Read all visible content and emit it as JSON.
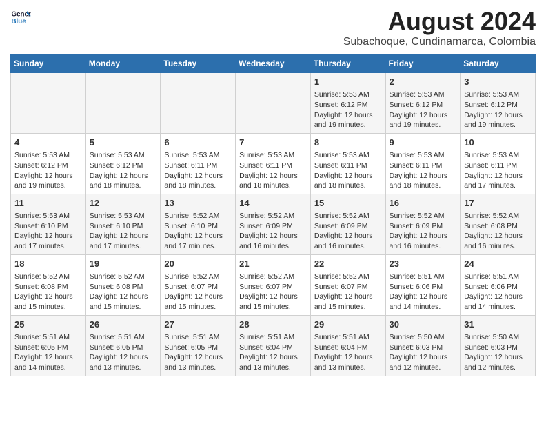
{
  "header": {
    "logo_line1": "General",
    "logo_line2": "Blue",
    "title": "August 2024",
    "subtitle": "Subachoque, Cundinamarca, Colombia"
  },
  "days_of_week": [
    "Sunday",
    "Monday",
    "Tuesday",
    "Wednesday",
    "Thursday",
    "Friday",
    "Saturday"
  ],
  "weeks": [
    [
      {
        "day": "",
        "content": ""
      },
      {
        "day": "",
        "content": ""
      },
      {
        "day": "",
        "content": ""
      },
      {
        "day": "",
        "content": ""
      },
      {
        "day": "1",
        "content": "Sunrise: 5:53 AM\nSunset: 6:12 PM\nDaylight: 12 hours\nand 19 minutes."
      },
      {
        "day": "2",
        "content": "Sunrise: 5:53 AM\nSunset: 6:12 PM\nDaylight: 12 hours\nand 19 minutes."
      },
      {
        "day": "3",
        "content": "Sunrise: 5:53 AM\nSunset: 6:12 PM\nDaylight: 12 hours\nand 19 minutes."
      }
    ],
    [
      {
        "day": "4",
        "content": "Sunrise: 5:53 AM\nSunset: 6:12 PM\nDaylight: 12 hours\nand 19 minutes."
      },
      {
        "day": "5",
        "content": "Sunrise: 5:53 AM\nSunset: 6:12 PM\nDaylight: 12 hours\nand 18 minutes."
      },
      {
        "day": "6",
        "content": "Sunrise: 5:53 AM\nSunset: 6:11 PM\nDaylight: 12 hours\nand 18 minutes."
      },
      {
        "day": "7",
        "content": "Sunrise: 5:53 AM\nSunset: 6:11 PM\nDaylight: 12 hours\nand 18 minutes."
      },
      {
        "day": "8",
        "content": "Sunrise: 5:53 AM\nSunset: 6:11 PM\nDaylight: 12 hours\nand 18 minutes."
      },
      {
        "day": "9",
        "content": "Sunrise: 5:53 AM\nSunset: 6:11 PM\nDaylight: 12 hours\nand 18 minutes."
      },
      {
        "day": "10",
        "content": "Sunrise: 5:53 AM\nSunset: 6:11 PM\nDaylight: 12 hours\nand 17 minutes."
      }
    ],
    [
      {
        "day": "11",
        "content": "Sunrise: 5:53 AM\nSunset: 6:10 PM\nDaylight: 12 hours\nand 17 minutes."
      },
      {
        "day": "12",
        "content": "Sunrise: 5:53 AM\nSunset: 6:10 PM\nDaylight: 12 hours\nand 17 minutes."
      },
      {
        "day": "13",
        "content": "Sunrise: 5:52 AM\nSunset: 6:10 PM\nDaylight: 12 hours\nand 17 minutes."
      },
      {
        "day": "14",
        "content": "Sunrise: 5:52 AM\nSunset: 6:09 PM\nDaylight: 12 hours\nand 16 minutes."
      },
      {
        "day": "15",
        "content": "Sunrise: 5:52 AM\nSunset: 6:09 PM\nDaylight: 12 hours\nand 16 minutes."
      },
      {
        "day": "16",
        "content": "Sunrise: 5:52 AM\nSunset: 6:09 PM\nDaylight: 12 hours\nand 16 minutes."
      },
      {
        "day": "17",
        "content": "Sunrise: 5:52 AM\nSunset: 6:08 PM\nDaylight: 12 hours\nand 16 minutes."
      }
    ],
    [
      {
        "day": "18",
        "content": "Sunrise: 5:52 AM\nSunset: 6:08 PM\nDaylight: 12 hours\nand 15 minutes."
      },
      {
        "day": "19",
        "content": "Sunrise: 5:52 AM\nSunset: 6:08 PM\nDaylight: 12 hours\nand 15 minutes."
      },
      {
        "day": "20",
        "content": "Sunrise: 5:52 AM\nSunset: 6:07 PM\nDaylight: 12 hours\nand 15 minutes."
      },
      {
        "day": "21",
        "content": "Sunrise: 5:52 AM\nSunset: 6:07 PM\nDaylight: 12 hours\nand 15 minutes."
      },
      {
        "day": "22",
        "content": "Sunrise: 5:52 AM\nSunset: 6:07 PM\nDaylight: 12 hours\nand 15 minutes."
      },
      {
        "day": "23",
        "content": "Sunrise: 5:51 AM\nSunset: 6:06 PM\nDaylight: 12 hours\nand 14 minutes."
      },
      {
        "day": "24",
        "content": "Sunrise: 5:51 AM\nSunset: 6:06 PM\nDaylight: 12 hours\nand 14 minutes."
      }
    ],
    [
      {
        "day": "25",
        "content": "Sunrise: 5:51 AM\nSunset: 6:05 PM\nDaylight: 12 hours\nand 14 minutes."
      },
      {
        "day": "26",
        "content": "Sunrise: 5:51 AM\nSunset: 6:05 PM\nDaylight: 12 hours\nand 13 minutes."
      },
      {
        "day": "27",
        "content": "Sunrise: 5:51 AM\nSunset: 6:05 PM\nDaylight: 12 hours\nand 13 minutes."
      },
      {
        "day": "28",
        "content": "Sunrise: 5:51 AM\nSunset: 6:04 PM\nDaylight: 12 hours\nand 13 minutes."
      },
      {
        "day": "29",
        "content": "Sunrise: 5:51 AM\nSunset: 6:04 PM\nDaylight: 12 hours\nand 13 minutes."
      },
      {
        "day": "30",
        "content": "Sunrise: 5:50 AM\nSunset: 6:03 PM\nDaylight: 12 hours\nand 12 minutes."
      },
      {
        "day": "31",
        "content": "Sunrise: 5:50 AM\nSunset: 6:03 PM\nDaylight: 12 hours\nand 12 minutes."
      }
    ]
  ]
}
